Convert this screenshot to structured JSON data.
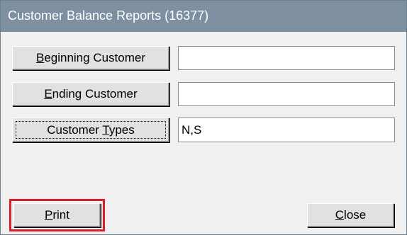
{
  "window": {
    "title": "Customer Balance Reports (16377)"
  },
  "form": {
    "beginning_customer": {
      "label_mnemonic": "B",
      "label_rest": "eginning Customer",
      "value": ""
    },
    "ending_customer": {
      "label_mnemonic": "E",
      "label_rest": "nding Customer",
      "value": ""
    },
    "customer_types": {
      "label_before": "Customer ",
      "label_mnemonic": "T",
      "label_rest": "ypes",
      "value": "N,S"
    }
  },
  "actions": {
    "print_mnemonic": "P",
    "print_rest": "rint",
    "close_mnemonic": "C",
    "close_rest": "lose"
  },
  "colors": {
    "titlebar": "#7d8fa1",
    "highlight": "#d9202a"
  }
}
